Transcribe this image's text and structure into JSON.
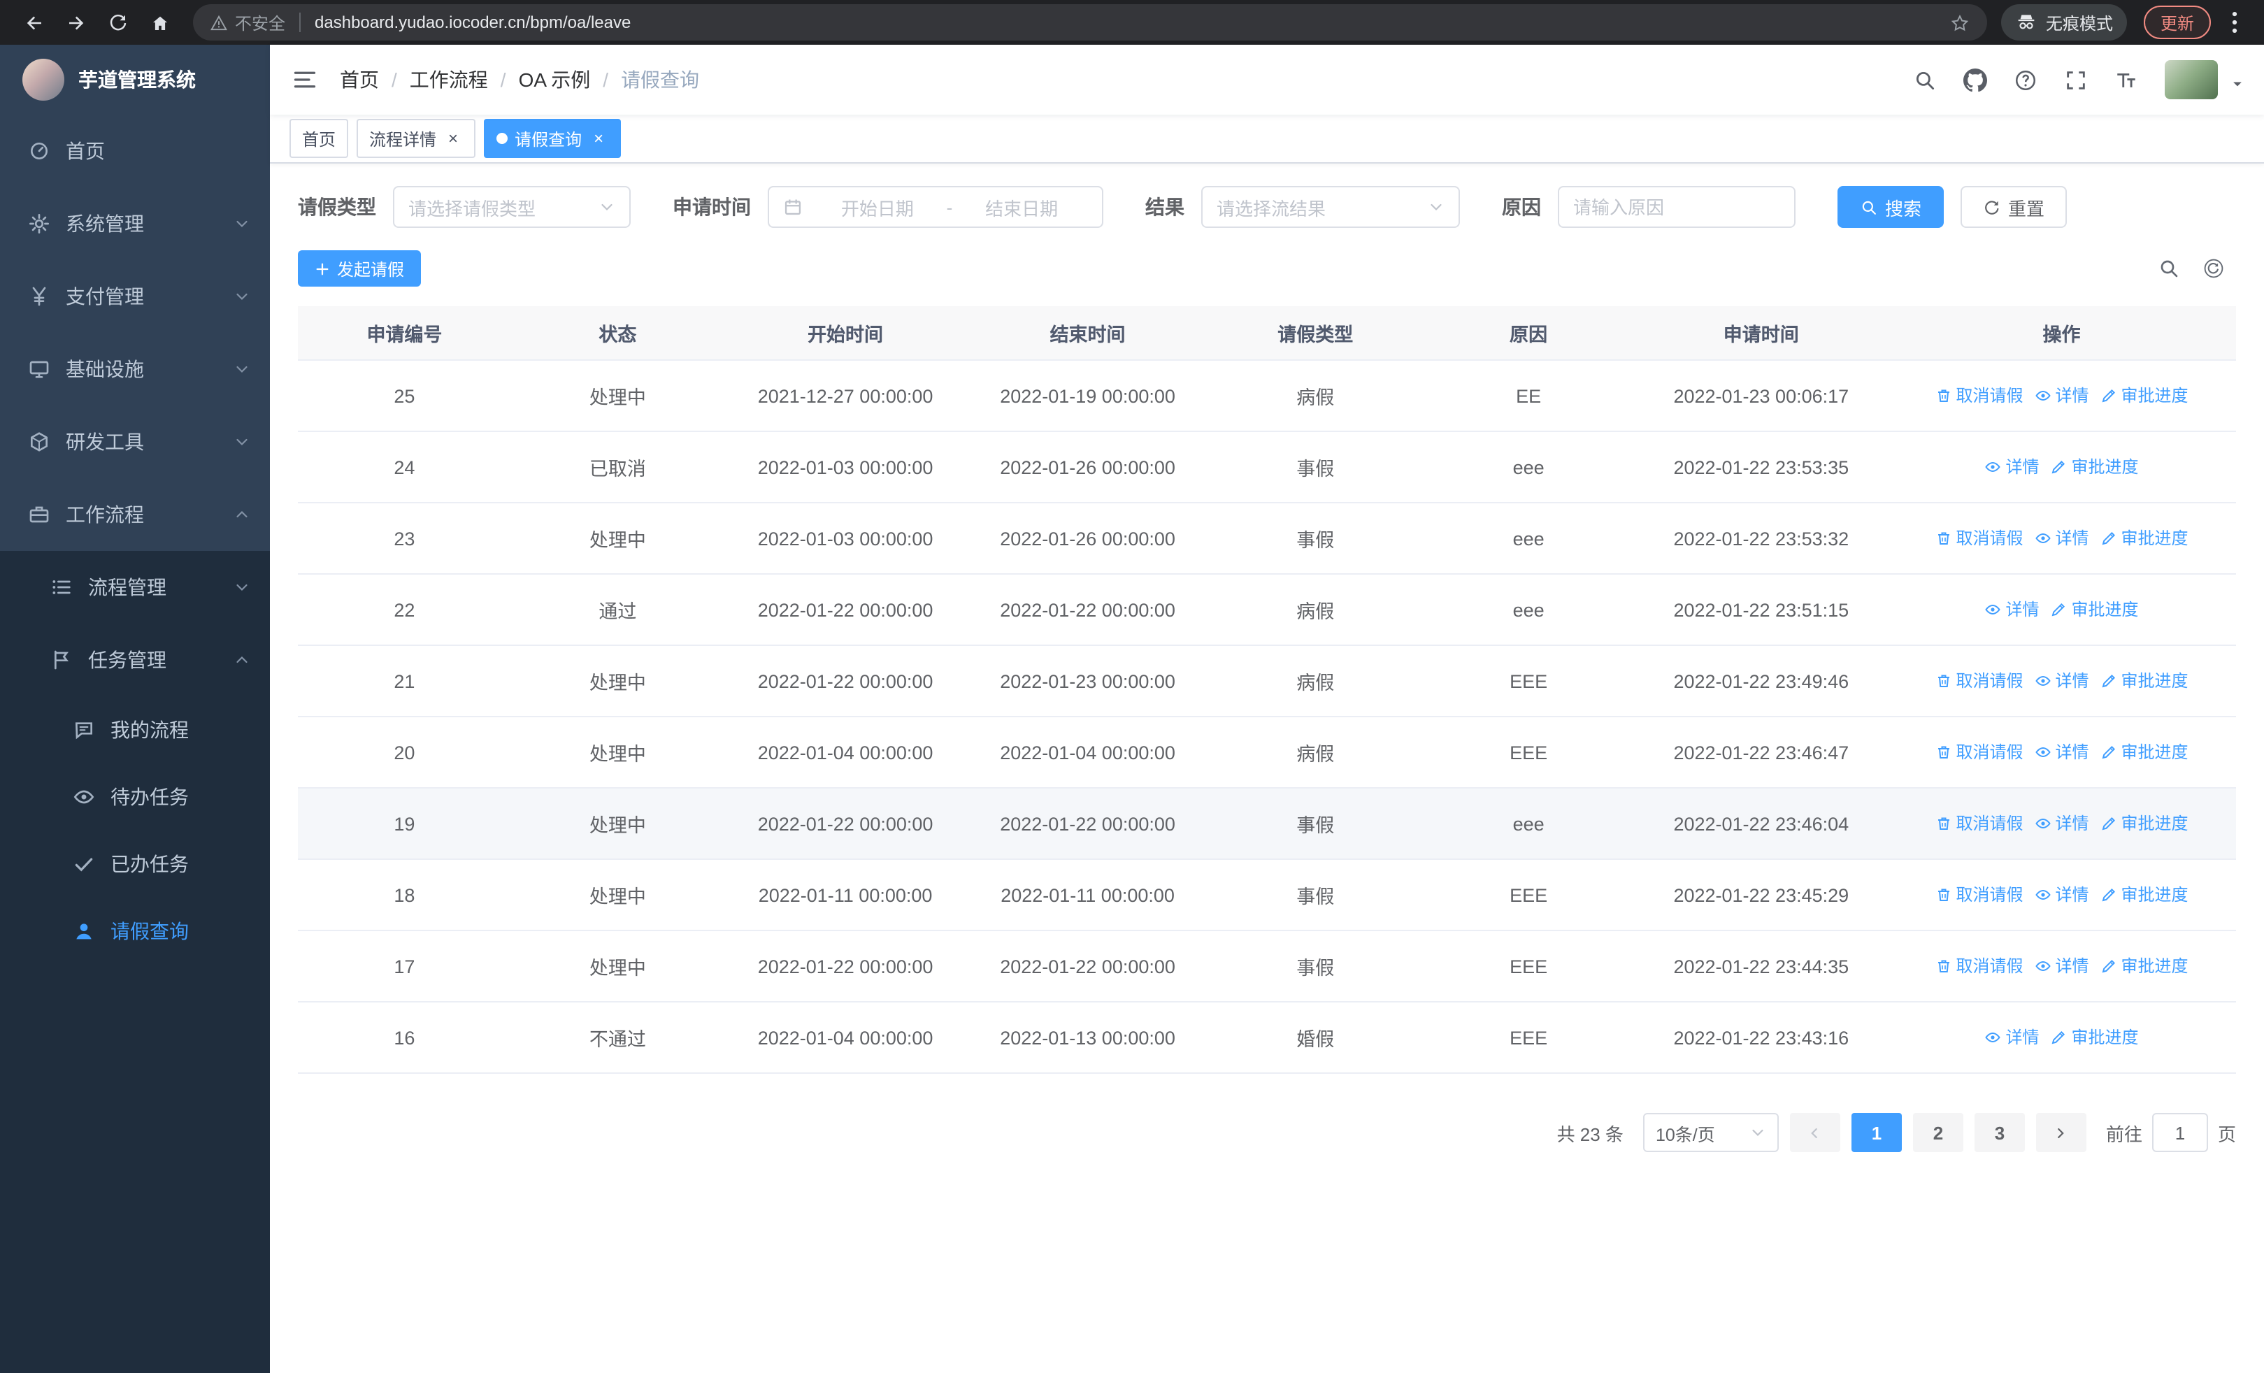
{
  "browser": {
    "security_label": "不安全",
    "url": "dashboard.yudao.iocoder.cn/bpm/oa/leave",
    "incognito_label": "无痕模式",
    "update_label": "更新",
    "icons": [
      "back-icon",
      "forward-icon",
      "reload-icon",
      "home-icon",
      "warning-icon",
      "star-icon",
      "incognito-icon",
      "kebab-menu-icon"
    ]
  },
  "sidebar": {
    "brand": "芋道管理系统",
    "items": [
      {
        "label": "首页",
        "icon": "dashboard-icon"
      },
      {
        "label": "系统管理",
        "icon": "gear-icon",
        "expand": "down"
      },
      {
        "label": "支付管理",
        "icon": "yen-icon",
        "expand": "down"
      },
      {
        "label": "基础设施",
        "icon": "monitor-icon",
        "expand": "down"
      },
      {
        "label": "研发工具",
        "icon": "cube-icon",
        "expand": "down"
      },
      {
        "label": "工作流程",
        "icon": "briefcase-icon",
        "expand": "up"
      }
    ],
    "workflow_children": [
      {
        "label": "流程管理",
        "icon": "list-icon",
        "expand": "down"
      },
      {
        "label": "任务管理",
        "icon": "flag-icon",
        "expand": "up"
      }
    ],
    "task_children": [
      {
        "label": "我的流程",
        "icon": "chat-icon"
      },
      {
        "label": "待办任务",
        "icon": "eye-icon"
      },
      {
        "label": "已办任务",
        "icon": "check-icon"
      },
      {
        "label": "请假查询",
        "icon": "user-icon",
        "active": true
      }
    ]
  },
  "navbar": {
    "breadcrumb": [
      "首页",
      "工作流程",
      "OA 示例",
      "请假查询"
    ],
    "icons": [
      "search-icon",
      "github-icon",
      "question-icon",
      "fullscreen-icon",
      "font-size-icon",
      "avatar",
      "caret-down-icon"
    ]
  },
  "tabs": [
    {
      "label": "首页",
      "closable": false,
      "active": false
    },
    {
      "label": "流程详情",
      "closable": true,
      "active": false
    },
    {
      "label": "请假查询",
      "closable": true,
      "active": true
    }
  ],
  "filters": {
    "leave_type_label": "请假类型",
    "leave_type_placeholder": "请选择请假类型",
    "apply_time_label": "申请时间",
    "date_start_placeholder": "开始日期",
    "date_separator": "-",
    "date_end_placeholder": "结束日期",
    "result_label": "结果",
    "result_placeholder": "请选择流结果",
    "reason_label": "原因",
    "reason_placeholder": "请输入原因",
    "search_label": "搜索",
    "reset_label": "重置"
  },
  "toolbar": {
    "create_label": "发起请假",
    "icons": [
      "search-icon",
      "refresh-icon"
    ]
  },
  "table": {
    "headers": [
      "申请编号",
      "状态",
      "开始时间",
      "结束时间",
      "请假类型",
      "原因",
      "申请时间",
      "操作"
    ],
    "action_defs": {
      "cancel": {
        "label": "取消请假",
        "icon": "trash-icon"
      },
      "detail": {
        "label": "详情",
        "icon": "eye-icon"
      },
      "progress": {
        "label": "审批进度",
        "icon": "edit-icon"
      }
    },
    "rows": [
      {
        "id": "25",
        "status": "处理中",
        "start_time": "2021-12-27 00:00:00",
        "end_time": "2022-01-19 00:00:00",
        "leave_type": "病假",
        "reason": "EE",
        "apply_time": "2022-01-23 00:06:17",
        "actions": [
          "cancel",
          "detail",
          "progress"
        ]
      },
      {
        "id": "24",
        "status": "已取消",
        "start_time": "2022-01-03 00:00:00",
        "end_time": "2022-01-26 00:00:00",
        "leave_type": "事假",
        "reason": "eee",
        "apply_time": "2022-01-22 23:53:35",
        "actions": [
          "detail",
          "progress"
        ]
      },
      {
        "id": "23",
        "status": "处理中",
        "start_time": "2022-01-03 00:00:00",
        "end_time": "2022-01-26 00:00:00",
        "leave_type": "事假",
        "reason": "eee",
        "apply_time": "2022-01-22 23:53:32",
        "actions": [
          "cancel",
          "detail",
          "progress"
        ]
      },
      {
        "id": "22",
        "status": "通过",
        "start_time": "2022-01-22 00:00:00",
        "end_time": "2022-01-22 00:00:00",
        "leave_type": "病假",
        "reason": "eee",
        "apply_time": "2022-01-22 23:51:15",
        "actions": [
          "detail",
          "progress"
        ]
      },
      {
        "id": "21",
        "status": "处理中",
        "start_time": "2022-01-22 00:00:00",
        "end_time": "2022-01-23 00:00:00",
        "leave_type": "病假",
        "reason": "EEE",
        "apply_time": "2022-01-22 23:49:46",
        "actions": [
          "cancel",
          "detail",
          "progress"
        ]
      },
      {
        "id": "20",
        "status": "处理中",
        "start_time": "2022-01-04 00:00:00",
        "end_time": "2022-01-04 00:00:00",
        "leave_type": "病假",
        "reason": "EEE",
        "apply_time": "2022-01-22 23:46:47",
        "actions": [
          "cancel",
          "detail",
          "progress"
        ]
      },
      {
        "id": "19",
        "status": "处理中",
        "start_time": "2022-01-22 00:00:00",
        "end_time": "2022-01-22 00:00:00",
        "leave_type": "事假",
        "reason": "eee",
        "apply_time": "2022-01-22 23:46:04",
        "actions": [
          "cancel",
          "detail",
          "progress"
        ],
        "hovered": true
      },
      {
        "id": "18",
        "status": "处理中",
        "start_time": "2022-01-11 00:00:00",
        "end_time": "2022-01-11 00:00:00",
        "leave_type": "事假",
        "reason": "EEE",
        "apply_time": "2022-01-22 23:45:29",
        "actions": [
          "cancel",
          "detail",
          "progress"
        ]
      },
      {
        "id": "17",
        "status": "处理中",
        "start_time": "2022-01-22 00:00:00",
        "end_time": "2022-01-22 00:00:00",
        "leave_type": "事假",
        "reason": "EEE",
        "apply_time": "2022-01-22 23:44:35",
        "actions": [
          "cancel",
          "detail",
          "progress"
        ]
      },
      {
        "id": "16",
        "status": "不通过",
        "start_time": "2022-01-04 00:00:00",
        "end_time": "2022-01-13 00:00:00",
        "leave_type": "婚假",
        "reason": "EEE",
        "apply_time": "2022-01-22 23:43:16",
        "actions": [
          "detail",
          "progress"
        ]
      }
    ]
  },
  "pagination": {
    "total_label": "共 23 条",
    "page_size_label": "10条/页",
    "pages": [
      "1",
      "2",
      "3"
    ],
    "current_page": "1",
    "goto_label": "前往",
    "goto_value": "1",
    "page_unit_label": "页"
  },
  "colors": {
    "accent": "#409eff",
    "sidebar_bg": "#304156",
    "submenu_bg": "#1f2d3d",
    "chrome_bg": "#202124",
    "update_red": "#f28b82"
  }
}
